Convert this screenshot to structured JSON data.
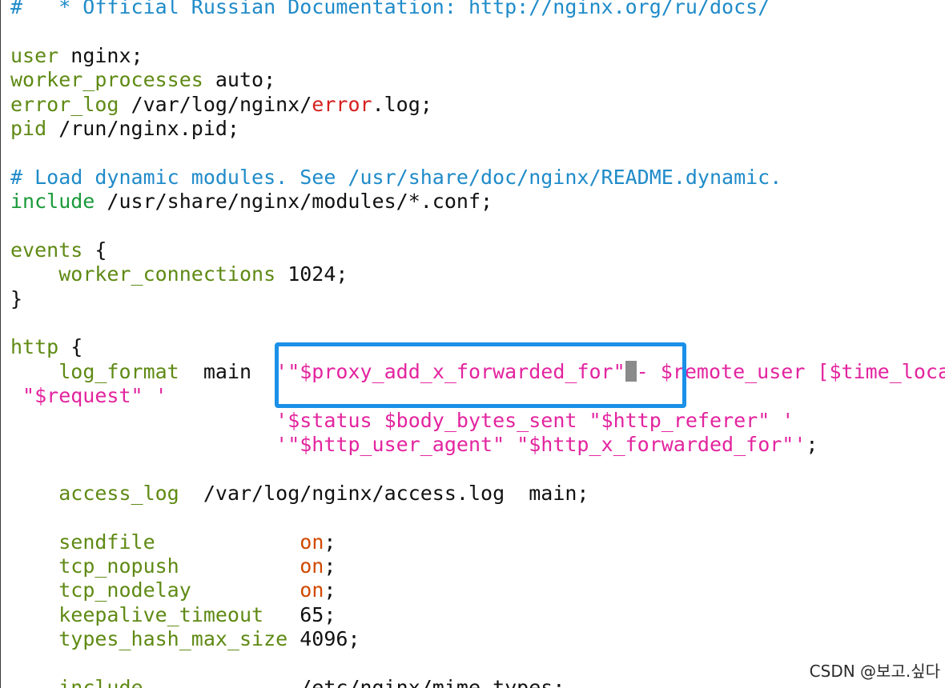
{
  "lines": [
    [
      {
        "text": "#   * Official Russian Documentation: http://nginx.org/ru/docs/",
        "kind": "comment"
      }
    ],
    [],
    [
      {
        "text": "user",
        "kind": "keyword"
      },
      {
        "text": " nginx;",
        "kind": "text"
      }
    ],
    [
      {
        "text": "worker_processes",
        "kind": "keyword"
      },
      {
        "text": " auto;",
        "kind": "text"
      }
    ],
    [
      {
        "text": "error_log",
        "kind": "keyword"
      },
      {
        "text": " /var/log/nginx/",
        "kind": "text"
      },
      {
        "text": "error",
        "kind": "error"
      },
      {
        "text": ".log;",
        "kind": "text"
      }
    ],
    [
      {
        "text": "pid",
        "kind": "keyword"
      },
      {
        "text": " /run/nginx.pid;",
        "kind": "text"
      }
    ],
    [],
    [
      {
        "text": "# Load dynamic modules. See /usr/share/doc/nginx/README.dynamic.",
        "kind": "comment"
      }
    ],
    [
      {
        "text": "include",
        "kind": "include"
      },
      {
        "text": " /usr/share/nginx/modules/*.conf;",
        "kind": "text"
      }
    ],
    [],
    [
      {
        "text": "events",
        "kind": "keyword"
      },
      {
        "text": " {",
        "kind": "text"
      }
    ],
    [
      {
        "text": "    ",
        "kind": "text"
      },
      {
        "text": "worker_connections",
        "kind": "keyword"
      },
      {
        "text": " 1024;",
        "kind": "text"
      }
    ],
    [
      {
        "text": "}",
        "kind": "text"
      }
    ],
    [],
    [
      {
        "text": "http",
        "kind": "keyword"
      },
      {
        "text": " {",
        "kind": "text"
      }
    ],
    [
      {
        "text": "    ",
        "kind": "text"
      },
      {
        "text": "log_format",
        "kind": "keyword"
      },
      {
        "text": "  main  ",
        "kind": "text"
      },
      {
        "text": "'\"$proxy_add_x_forwarded_for\"",
        "kind": "string"
      },
      {
        "text": "",
        "kind": "cursor"
      },
      {
        "text": "- $remote_user [$time_local]",
        "kind": "string"
      }
    ],
    [
      {
        "text": " \"$request\" '",
        "kind": "string"
      }
    ],
    [
      {
        "text": "                      ",
        "kind": "text"
      },
      {
        "text": "'$status $body_bytes_sent \"$http_referer\" '",
        "kind": "string"
      }
    ],
    [
      {
        "text": "                      ",
        "kind": "text"
      },
      {
        "text": "'\"$http_user_agent\" \"$http_x_forwarded_for\"'",
        "kind": "string"
      },
      {
        "text": ";",
        "kind": "text"
      }
    ],
    [],
    [
      {
        "text": "    ",
        "kind": "text"
      },
      {
        "text": "access_log",
        "kind": "keyword"
      },
      {
        "text": "  /var/log/nginx/access.log  main;",
        "kind": "text"
      }
    ],
    [],
    [
      {
        "text": "    ",
        "kind": "text"
      },
      {
        "text": "sendfile",
        "kind": "keyword"
      },
      {
        "text": "            ",
        "kind": "text"
      },
      {
        "text": "on",
        "kind": "value"
      },
      {
        "text": ";",
        "kind": "text"
      }
    ],
    [
      {
        "text": "    ",
        "kind": "text"
      },
      {
        "text": "tcp_nopush",
        "kind": "keyword"
      },
      {
        "text": "          ",
        "kind": "text"
      },
      {
        "text": "on",
        "kind": "value"
      },
      {
        "text": ";",
        "kind": "text"
      }
    ],
    [
      {
        "text": "    ",
        "kind": "text"
      },
      {
        "text": "tcp_nodelay",
        "kind": "keyword"
      },
      {
        "text": "         ",
        "kind": "text"
      },
      {
        "text": "on",
        "kind": "value"
      },
      {
        "text": ";",
        "kind": "text"
      }
    ],
    [
      {
        "text": "    ",
        "kind": "text"
      },
      {
        "text": "keepalive_timeout",
        "kind": "keyword"
      },
      {
        "text": "   65;",
        "kind": "text"
      }
    ],
    [
      {
        "text": "    ",
        "kind": "text"
      },
      {
        "text": "types_hash_max_size",
        "kind": "keyword"
      },
      {
        "text": " 4096;",
        "kind": "text"
      }
    ],
    [],
    [
      {
        "text": "    ",
        "kind": "text"
      },
      {
        "text": "include",
        "kind": "keyword"
      },
      {
        "text": "             /etc/nginx/mime.types;",
        "kind": "text"
      }
    ]
  ],
  "watermark": "CSDN @보고.싶다",
  "colors": {
    "highlight_border": "#1a90e8",
    "comment": "#1f8bc9",
    "keyword": "#5f8a14",
    "string": "#e3249f",
    "value": "#d04a00"
  }
}
